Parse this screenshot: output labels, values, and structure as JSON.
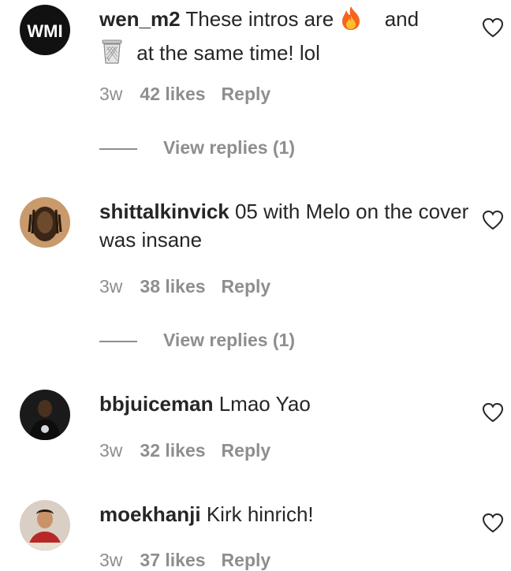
{
  "comments": [
    {
      "username": "wen_m2",
      "text_before": "These intros are",
      "emoji1": "fire-emoji",
      "text_middle": "and",
      "emoji2": "wastebasket-emoji",
      "text_after": "at the same time! lol",
      "avatar_text": "WMI",
      "age": "3w",
      "likes": "42 likes",
      "reply": "Reply",
      "view_replies": "View replies (1)"
    },
    {
      "username": "shittalkinvick",
      "text": "05 with Melo on the cover was insane",
      "age": "3w",
      "likes": "38 likes",
      "reply": "Reply",
      "view_replies": "View replies (1)"
    },
    {
      "username": "bbjuiceman",
      "text": "Lmao Yao",
      "age": "3w",
      "likes": "32 likes",
      "reply": "Reply"
    },
    {
      "username": "moekhanji",
      "text": "Kirk hinrich!",
      "age": "3w",
      "likes": "37 likes",
      "reply": "Reply"
    }
  ],
  "colors": {
    "text": "#262626",
    "muted": "#8e8e8e"
  },
  "icons": [
    "heart-outline-icon"
  ]
}
